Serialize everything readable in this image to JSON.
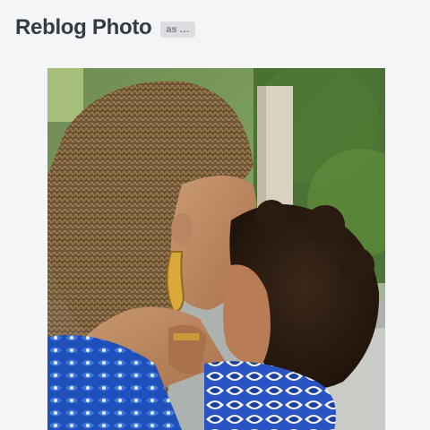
{
  "header": {
    "title": "Reblog Photo",
    "blog_select_label": "as …"
  },
  "photo": {
    "icon": "photo-image"
  }
}
